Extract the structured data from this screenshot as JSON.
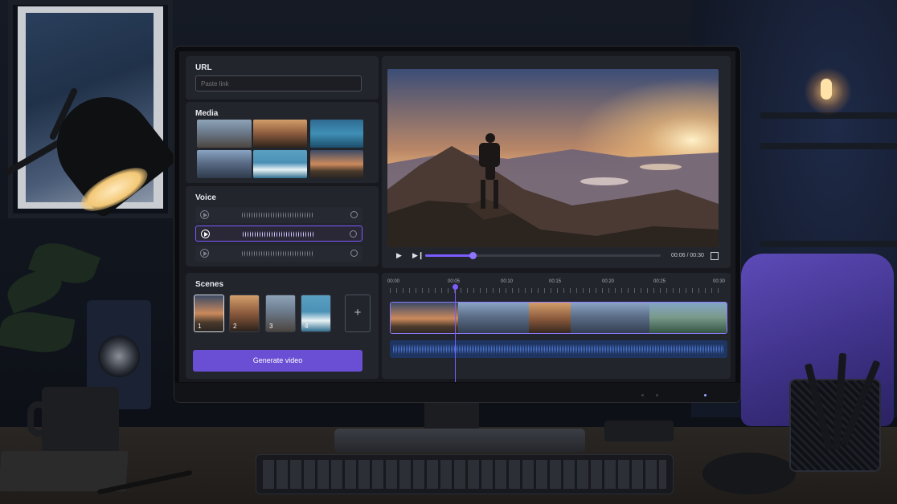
{
  "panels": {
    "url": {
      "title": "URL",
      "placeholder": "Paste link"
    },
    "media": {
      "title": "Media",
      "items": [
        "city-street",
        "figure-at-window",
        "shark-underwater",
        "mountain-valley",
        "coastal-waves",
        "hiker-at-sunset"
      ]
    },
    "voice": {
      "title": "Voice",
      "options": [
        {
          "selected": false
        },
        {
          "selected": true
        },
        {
          "selected": false
        }
      ]
    },
    "scenes": {
      "title": "Scenes",
      "items": [
        {
          "number": "1"
        },
        {
          "number": "2"
        },
        {
          "number": "3"
        },
        {
          "number": "4"
        }
      ],
      "add_icon": "plus-icon"
    }
  },
  "generate_button": {
    "label": "Generate video"
  },
  "player": {
    "time": "00:06 / 00:30",
    "progress": 0.2,
    "icons": [
      "play-icon",
      "skip-forward-icon",
      "fullscreen-icon"
    ]
  },
  "timeline": {
    "ruler": [
      "00:00",
      "00:05",
      "00:10",
      "00:15",
      "00:20",
      "00:25",
      "00:30"
    ],
    "playhead_time": "00:05"
  },
  "colors": {
    "accent": "#7b5cff",
    "button": "#6a4fd4",
    "panel": "#22252c",
    "screen": "#17191e",
    "audio_track": "#1f3561"
  }
}
